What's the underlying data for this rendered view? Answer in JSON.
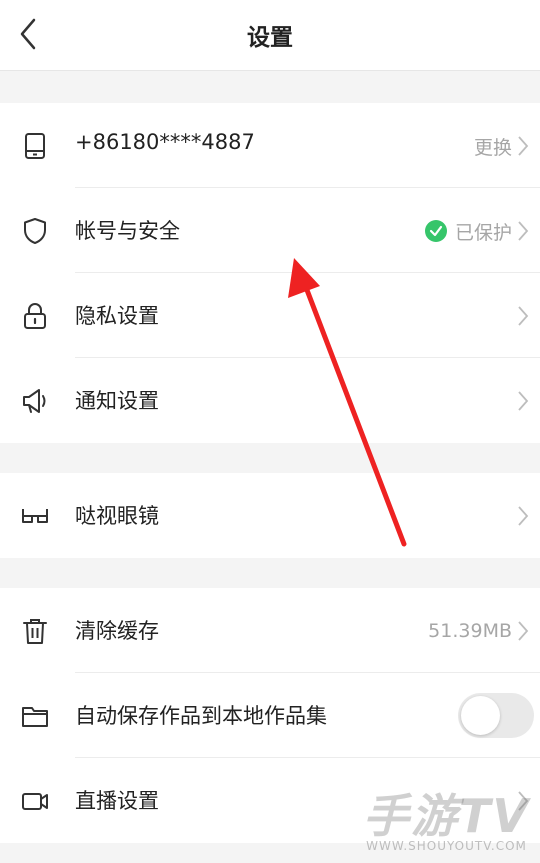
{
  "header": {
    "title": "设置",
    "back_icon": "back-chevron-icon"
  },
  "groups": {
    "account": [
      {
        "label": "+86180****4887",
        "value": "更换",
        "icon": "phone-icon"
      },
      {
        "label": "帐号与安全",
        "value": "已保护",
        "icon": "shield-icon"
      },
      {
        "label": "隐私设置",
        "value": "",
        "icon": "lock-icon"
      },
      {
        "label": "通知设置",
        "value": "",
        "icon": "speaker-icon"
      }
    ],
    "glasses": [
      {
        "label": "哒视眼镜",
        "value": "",
        "icon": "glasses-icon"
      }
    ],
    "storage": [
      {
        "label": "清除缓存",
        "value": "51.39MB",
        "icon": "trash-icon"
      },
      {
        "label": "自动保存作品到本地作品集",
        "toggle_on": false,
        "icon": "folder-icon"
      },
      {
        "label": "直播设置",
        "value": "",
        "icon": "video-camera-icon"
      }
    ]
  },
  "watermark": {
    "main": "手游TV",
    "sub": "WWW.SHOUYOUTV.COM"
  },
  "colors": {
    "annotation_arrow": "#ee2222",
    "protected_badge": "#36c56a"
  }
}
